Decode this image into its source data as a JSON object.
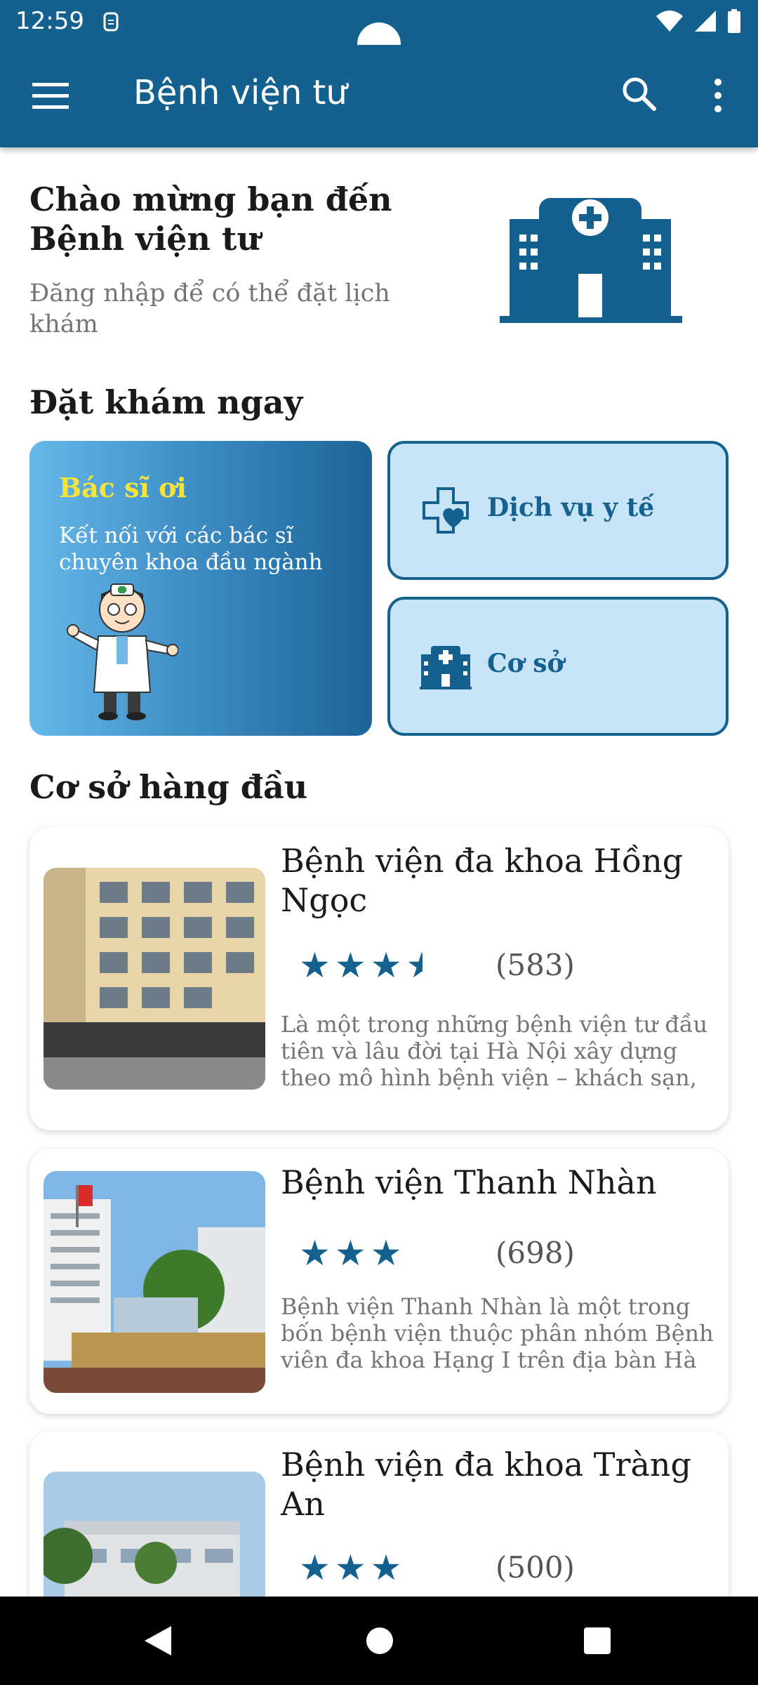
{
  "status_bar": {
    "time": "12:59"
  },
  "app_bar": {
    "title": "Bệnh viện tư"
  },
  "welcome": {
    "title": "Chào mừng bạn đến Bệnh viện tư",
    "subtitle": "Đăng nhập để có thể đặt lịch khám"
  },
  "booking": {
    "section_title": "Đặt khám ngay",
    "doctor_card": {
      "title": "Bác sĩ ơi",
      "description": "Kết nối với các bác sĩ chuyên khoa đầu ngành"
    },
    "services_label": "Dịch vụ y tế",
    "facilities_label": "Cơ sở"
  },
  "top_facilities": {
    "section_title": "Cơ sở hàng đầu",
    "items": [
      {
        "name": "Bệnh viện đa khoa Hồng Ngọc",
        "rating": 3.5,
        "stars": "★★★",
        "reviews": "(583)",
        "description": "Là một trong những bệnh viện tư đầu tiên và lâu đời tại Hà Nội xây dựng theo mô hình bệnh viện – khách sạn, đến nay"
      },
      {
        "name": "Bệnh viện Thanh Nhàn",
        "rating": 3,
        "stars": "★★★",
        "reviews": "(698)",
        "description": "Bệnh viện Thanh Nhàn là một trong bốn bệnh viện thuộc phân nhóm Bệnh viên đa khoa Hạng I trên địa bàn Hà Nội. Đơn"
      },
      {
        "name": "Bệnh viện đa khoa Tràng An",
        "rating": 3,
        "stars": "★★★",
        "reviews": "(500)"
      }
    ]
  },
  "colors": {
    "primary": "#14618f",
    "tile_bg": "#c6e4f6",
    "doctor_title": "#f3e33a"
  },
  "icons": {
    "menu": "menu-icon",
    "search": "search-icon",
    "more": "more-vert-icon",
    "services": "medical-heart-icon",
    "facilities": "hospital-building-icon"
  }
}
